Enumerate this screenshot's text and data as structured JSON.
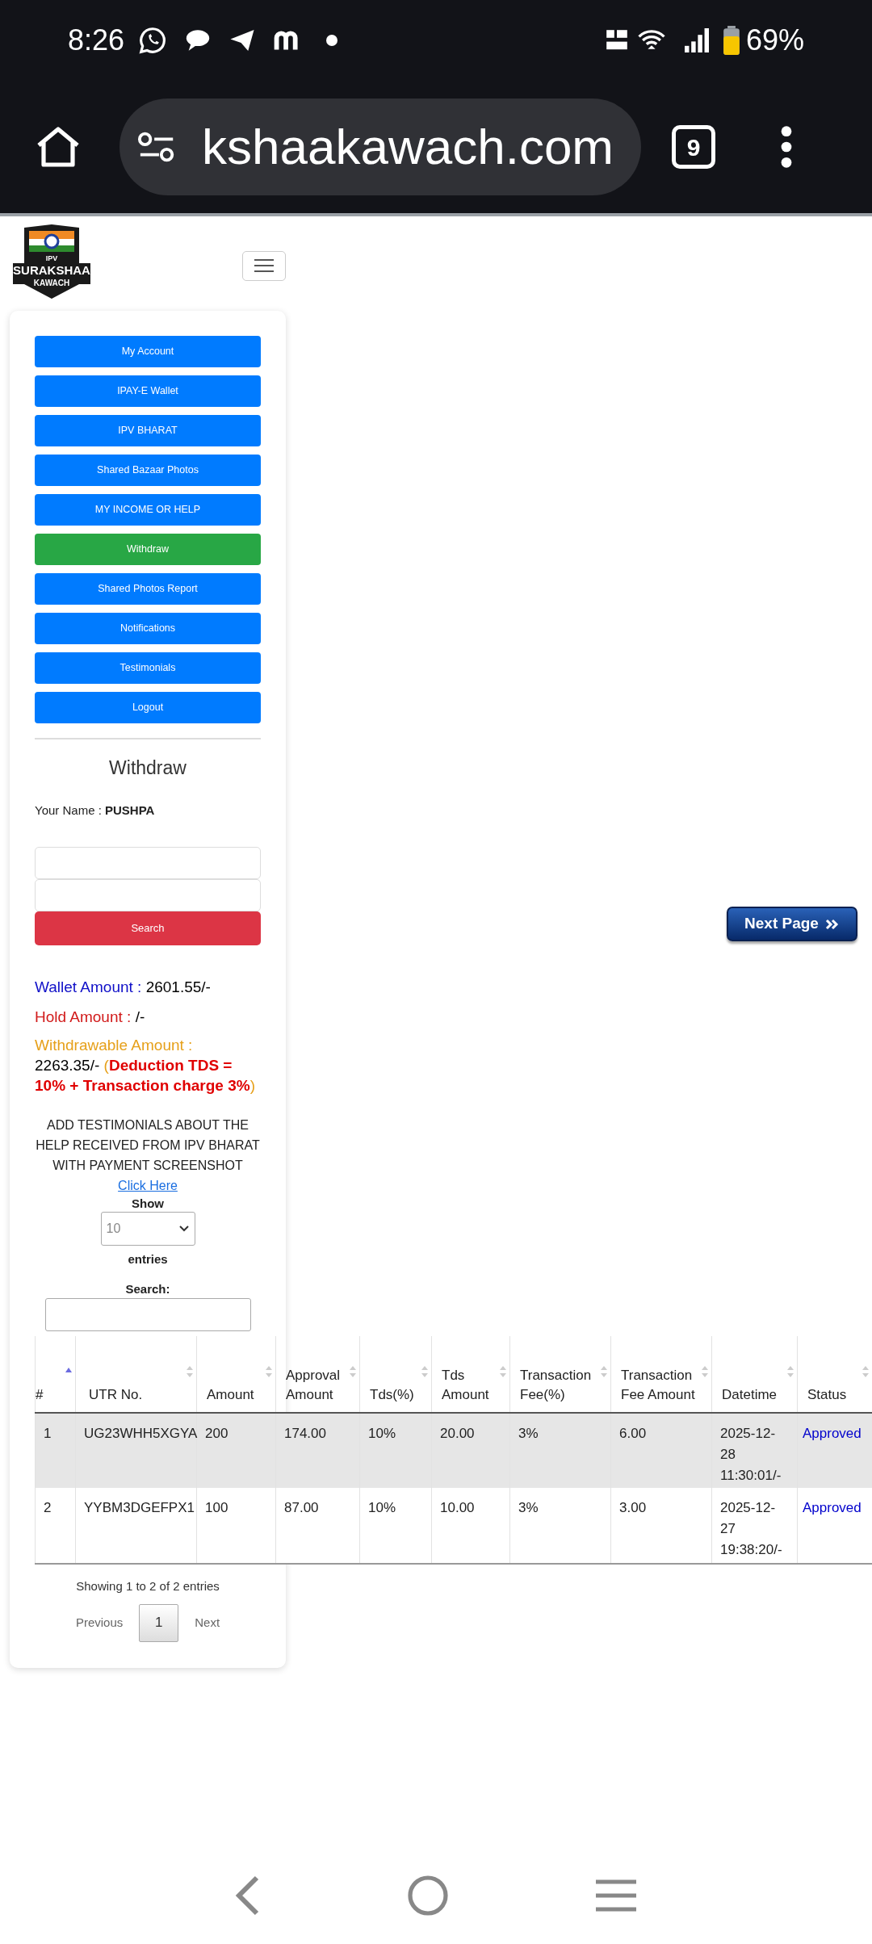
{
  "status_bar": {
    "time": "8:26",
    "battery": "69%"
  },
  "browser": {
    "url": "kshaakawach.com",
    "tab_count": "9"
  },
  "logo": {
    "lines": [
      "IPV",
      "SURAKSHAA",
      "KAWACH"
    ]
  },
  "menu": [
    {
      "label": "My Account",
      "selected": false
    },
    {
      "label": "IPAY-E Wallet",
      "selected": false
    },
    {
      "label": "IPV BHARAT",
      "selected": false
    },
    {
      "label": "Shared Bazaar Photos",
      "selected": false
    },
    {
      "label": "MY INCOME OR HELP",
      "selected": false
    },
    {
      "label": "Withdraw",
      "selected": true
    },
    {
      "label": "Shared Photos Report",
      "selected": false
    },
    {
      "label": "Notifications",
      "selected": false
    },
    {
      "label": "Testimonials",
      "selected": false
    },
    {
      "label": "Logout",
      "selected": false
    }
  ],
  "withdraw": {
    "title": "Withdraw",
    "name_label": "Your Name :",
    "name": "PUSHPA",
    "search_button": "Search"
  },
  "amounts": {
    "wallet_label": "Wallet Amount :",
    "wallet_value": "2601.55/-",
    "hold_label": "Hold Amount :",
    "hold_value": "/-",
    "withdrawable_label": "Withdrawable Amount :",
    "withdrawable_value": "2263.35/-",
    "note": "(**Deduction TDS = 10% + Transaction charge 3%**)"
  },
  "testimonial": {
    "text": "ADD TESTIMONIALS ABOUT THE HELP RECEIVED FROM IPV BHARAT WITH PAYMENT SCREENSHOT",
    "link": "Click Here"
  },
  "table_controls": {
    "show_label": "Show",
    "page_length": "10",
    "entries_label": "entries",
    "search_label": "Search:"
  },
  "table": {
    "columns": [
      {
        "label": "#",
        "sorted": true
      },
      {
        "label": "UTR No.",
        "sorted": false
      },
      {
        "label": "Amount",
        "sorted": false
      },
      {
        "label": "Approval Amount",
        "sorted": false
      },
      {
        "label": "Tds(%)",
        "sorted": false
      },
      {
        "label": "Tds Amount",
        "sorted": false
      },
      {
        "label": "Transaction Fee(%)",
        "sorted": false
      },
      {
        "label": "Transaction Fee Amount",
        "sorted": false
      },
      {
        "label": "Datetime",
        "sorted": false
      },
      {
        "label": "Status",
        "sorted": false
      }
    ],
    "rows": [
      {
        "cells": [
          "1",
          "UG23WHH5XGYA",
          "200",
          "174.00",
          "10%",
          "20.00",
          "3%",
          "6.00",
          "2025-12-28 11:30:01/-",
          "Approved"
        ]
      },
      {
        "cells": [
          "2",
          "YYBM3DGEFPX1",
          "100",
          "87.00",
          "10%",
          "10.00",
          "3%",
          "3.00",
          "2025-12-27 19:38:20/-",
          "Approved"
        ]
      }
    ]
  },
  "table_info": "Showing 1 to 2 of 2 entries",
  "pagination": {
    "previous": "Previous",
    "pages": [
      {
        "label": "1",
        "selected": true
      }
    ],
    "next": "Next"
  },
  "next_page_button": "Next Page"
}
